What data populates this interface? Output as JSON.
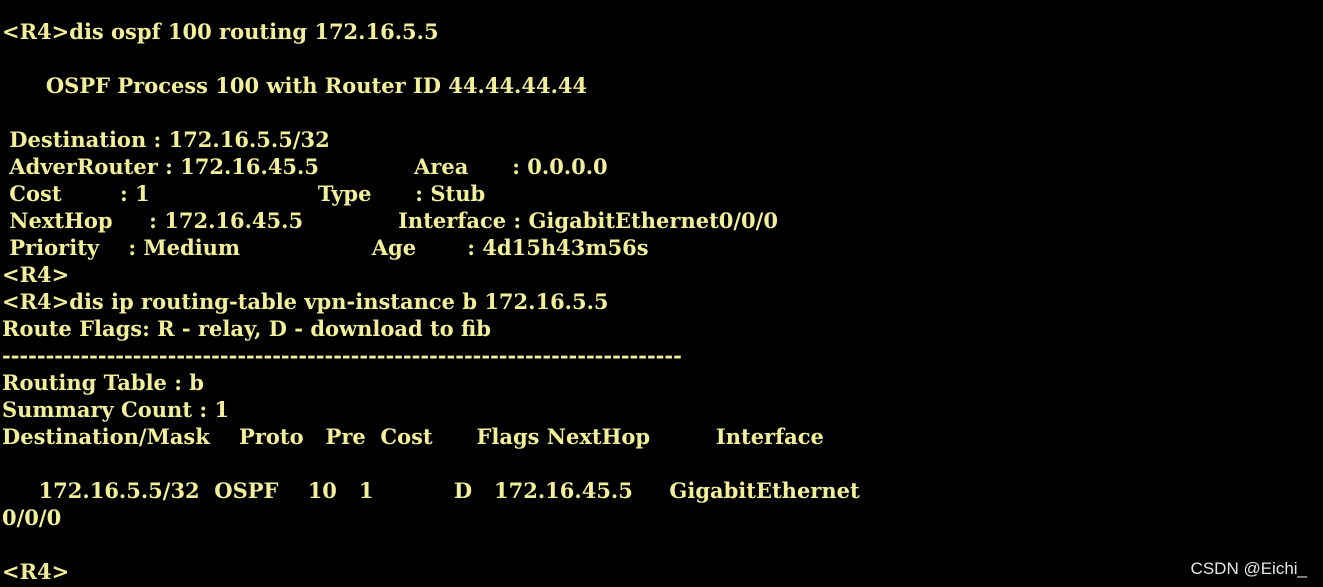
{
  "terminal": {
    "text_color": "#f2ef9a",
    "background": "#000000",
    "lines": [
      "<R4>dis ospf 100 routing 172.16.5.5",
      "",
      "      OSPF Process 100 with Router ID 44.44.44.44",
      "",
      " Destination : 172.16.5.5/32",
      " AdverRouter : 172.16.45.5             Area      : 0.0.0.0",
      " Cost        : 1                       Type      : Stub",
      " NextHop     : 172.16.45.5             Interface : GigabitEthernet0/0/0",
      " Priority    : Medium                  Age       : 4d15h43m56s",
      "<R4>",
      "<R4>dis ip routing-table vpn-instance b 172.16.5.5",
      "Route Flags: R - relay, D - download to fib",
      "------------------------------------------------------------------------------",
      "Routing Table : b",
      "Summary Count : 1",
      "Destination/Mask    Proto   Pre  Cost      Flags NextHop         Interface",
      "",
      "     172.16.5.5/32  OSPF    10   1           D   172.16.45.5     GigabitEthernet",
      "0/0/0",
      "",
      "<R4>"
    ]
  },
  "watermark": {
    "text": "CSDN @Eichi_"
  }
}
